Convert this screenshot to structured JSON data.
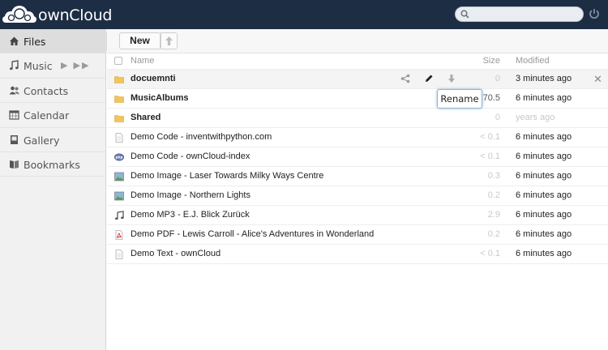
{
  "header": {
    "brand": "ownCloud",
    "search_placeholder": "",
    "colors": {
      "header_bg": "#1d2d44"
    }
  },
  "navigation": {
    "items": [
      {
        "label": "Files",
        "icon": "home-icon",
        "active": true
      },
      {
        "label": "Music",
        "icon": "music-note-icon",
        "active": false,
        "controls": "▶ ▶▶"
      },
      {
        "label": "Contacts",
        "icon": "contacts-icon",
        "active": false
      },
      {
        "label": "Calendar",
        "icon": "calendar-icon",
        "active": false
      },
      {
        "label": "Gallery",
        "icon": "gallery-icon",
        "active": false
      },
      {
        "label": "Bookmarks",
        "icon": "bookmarks-icon",
        "active": false
      }
    ]
  },
  "controls": {
    "new_label": "New"
  },
  "table": {
    "columns": {
      "name": "Name",
      "size": "Size",
      "modified": "Modified"
    },
    "rows": [
      {
        "name": "docuemnti",
        "type": "folder",
        "size": "0",
        "modified": "3 minutes ago",
        "hover": true
      },
      {
        "name": "MusicAlbums",
        "type": "folder",
        "size": "70.5",
        "modified": "6 minutes ago"
      },
      {
        "name": "Shared",
        "type": "folder",
        "size": "0",
        "modified": "years ago",
        "faded": true
      },
      {
        "name": "Demo Code - inventwithpython.com",
        "type": "text",
        "size": "< 0.1",
        "modified": "6 minutes ago"
      },
      {
        "name": "Demo Code - ownCloud-index",
        "type": "php",
        "size": "< 0.1",
        "modified": "6 minutes ago"
      },
      {
        "name": "Demo Image - Laser Towards Milky Ways Centre",
        "type": "image",
        "size": "0.3",
        "modified": "6 minutes ago"
      },
      {
        "name": "Demo Image - Northern Lights",
        "type": "image",
        "size": "0.2",
        "modified": "6 minutes ago"
      },
      {
        "name": "Demo MP3 - E.J. Blick Zurück",
        "type": "audio",
        "size": "2.9",
        "modified": "6 minutes ago"
      },
      {
        "name": "Demo PDF - Lewis Carroll - Alice's Adventures in Wonderland",
        "type": "pdf",
        "size": "0.2",
        "modified": "6 minutes ago"
      },
      {
        "name": "Demo Text - ownCloud",
        "type": "text",
        "size": "< 0.1",
        "modified": "6 minutes ago"
      }
    ]
  },
  "tooltip": {
    "label": "Rename"
  }
}
